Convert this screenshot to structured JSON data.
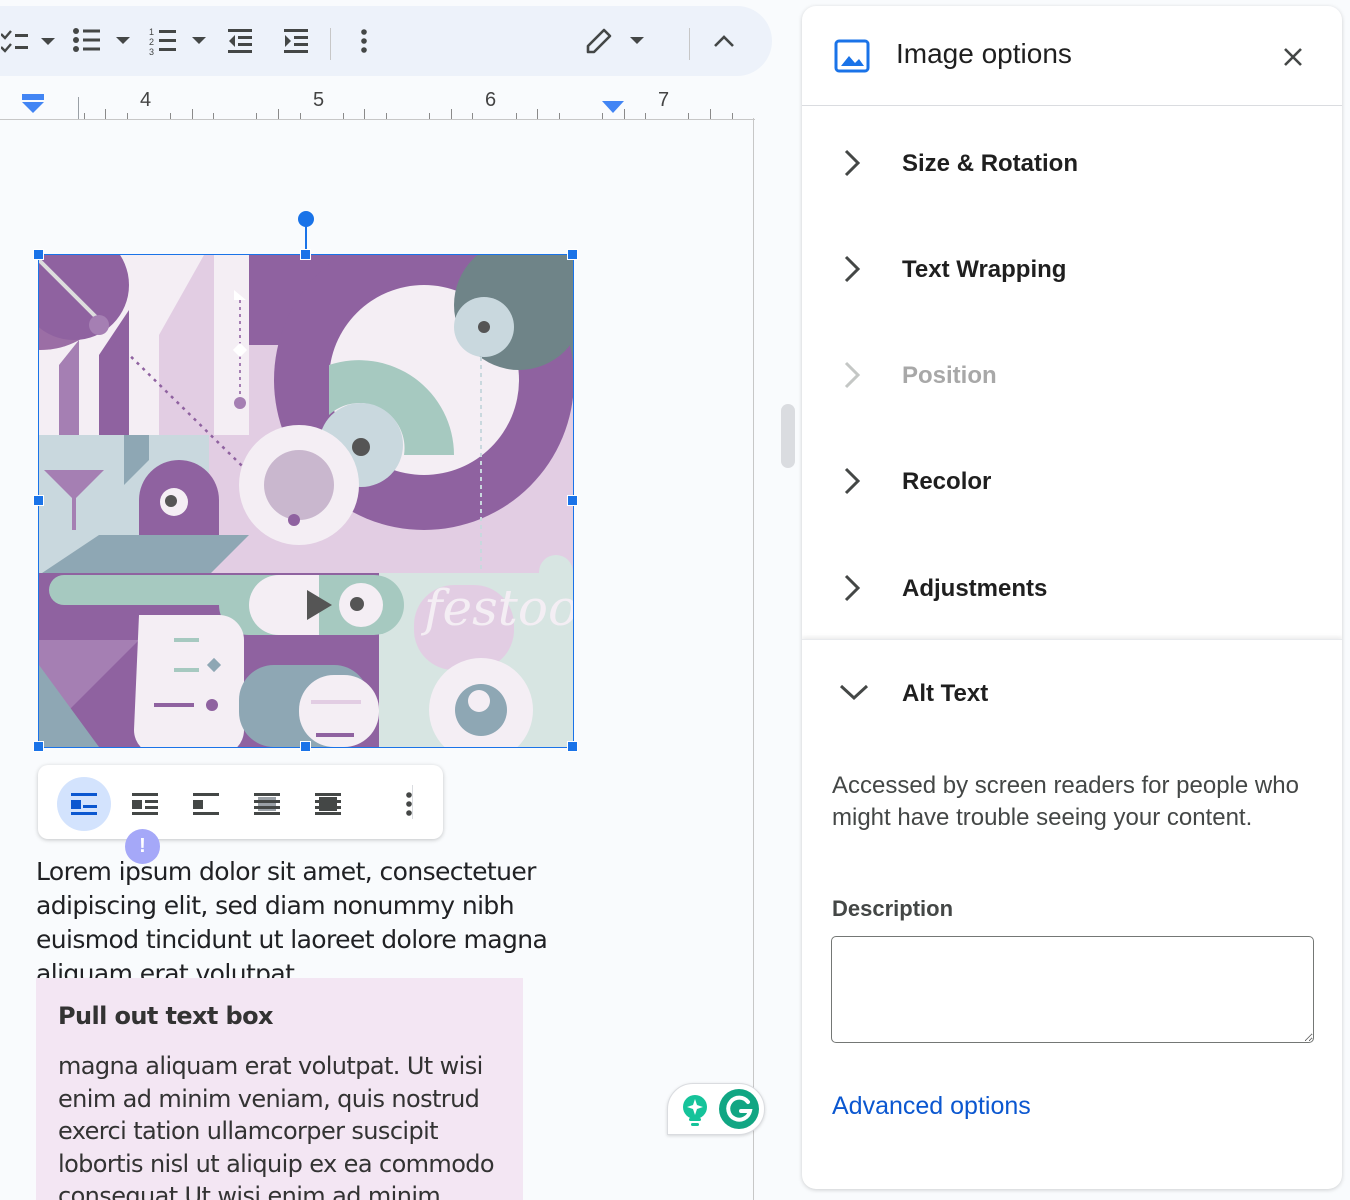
{
  "ruler": {
    "numbers": [
      "4",
      "5",
      "6",
      "7"
    ]
  },
  "image": {
    "wordmark": "festoon"
  },
  "document": {
    "paragraph": "Lorem ipsum dolor sit amet, consectetuer adipiscing elit, sed diam nonummy nibh euismod tincidunt ut laoreet dolore magna aliquam erat volutpat.",
    "pullbox": {
      "title": "Pull out text box",
      "body": "magna aliquam erat volutpat. Ut wisi enim ad minim veniam, quis nostrud exerci tation ullamcorper suscipit lobortis nisl ut aliquip ex ea commodo consequat.Ut wisi enim ad minim"
    },
    "warning_badge": "!"
  },
  "sidebar": {
    "title": "Image options",
    "sections": [
      {
        "label": "Size & Rotation",
        "disabled": false
      },
      {
        "label": "Text Wrapping",
        "disabled": false
      },
      {
        "label": "Position",
        "disabled": true
      },
      {
        "label": "Recolor",
        "disabled": false
      },
      {
        "label": "Adjustments",
        "disabled": false
      }
    ],
    "alt_text": {
      "label": "Alt Text",
      "description": "Accessed by screen readers for people who might have trouble seeing your content.",
      "field_label": "Description",
      "field_value": "",
      "advanced_link": "Advanced options"
    }
  },
  "colors": {
    "accent": "#1a73e8",
    "toolbar_bg": "#edf2fa",
    "link": "#0b57d0",
    "pullbox_bg": "#f3e6f3",
    "grammarly": "#15c39a"
  },
  "icons": [
    "checklist-icon",
    "bullet-list-icon",
    "numbered-list-icon",
    "decrease-indent-icon",
    "increase-indent-icon",
    "more-vert-icon",
    "edit-pencil-icon",
    "chevron-up-icon",
    "image-icon",
    "close-icon",
    "chevron-right-icon",
    "chevron-down-icon",
    "wrap-inline-icon",
    "wrap-text-icon",
    "break-text-icon",
    "behind-text-icon",
    "in-front-text-icon",
    "lightbulb-icon",
    "grammarly-icon"
  ]
}
